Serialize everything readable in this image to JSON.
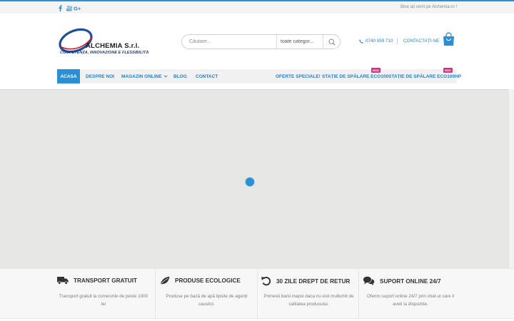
{
  "topbar": {
    "welcome": "Bine ați venit pe Alchemia.ro !",
    "social": [
      {
        "name": "facebook-icon",
        "glyph": "f"
      },
      {
        "name": "youtube-icon",
        "glyph": "yt"
      },
      {
        "name": "google-plus-icon",
        "glyph": "G+"
      }
    ]
  },
  "logo": {
    "name": "ALCHEMIA S.r.l.",
    "tagline": "COMPETENZA, INNOVAZIONE E FLESSIBILITÀ"
  },
  "search": {
    "placeholder": "Căutare...",
    "category": "toate categor..."
  },
  "header": {
    "phone": "0740 059 710",
    "contact": "CONTACTAȚI-NE"
  },
  "nav": {
    "items": [
      {
        "label": "ACASA",
        "active": true
      },
      {
        "label": "DESPRE NOI"
      },
      {
        "label": "MAGAZIN ONLINE"
      },
      {
        "label": "BLOG"
      },
      {
        "label": "CONTACT"
      },
      {
        "label": "OFERTE SPECIALE!"
      },
      {
        "label": "STAȚIE DE SPĂLARE ECO100",
        "badge": "NOU"
      },
      {
        "label": "STAȚIE DE SPĂLARE ECO100HP",
        "badge": "NOU"
      }
    ]
  },
  "features": [
    {
      "icon": "truck-icon",
      "title": "TRANSPORT GRATUIT",
      "line1": "Transport gratuit la comenzile de peste 1000",
      "line2": "lei"
    },
    {
      "icon": "leaf-icon",
      "title": "PRODUSE ECOLOGICE",
      "line1": "Produse pe bază de apă lipsite de agenți",
      "line2": "caustici."
    },
    {
      "icon": "undo-icon",
      "title": "30 ZILE DREPT DE RETUR",
      "line1": "Primesti banii inapoi daca nu esti multumit de",
      "line2": "calitatea produsului."
    },
    {
      "icon": "chat-icon",
      "title": "SUPORT ONLINE 24/7",
      "line1": "Oferim suport online 24/7 prin chat-ul care il",
      "line2": "aveti la dispozitie."
    }
  ],
  "colors": {
    "accent": "#2b8fd6",
    "badge": "#d63384",
    "map_bg": "#e6e6e4"
  }
}
